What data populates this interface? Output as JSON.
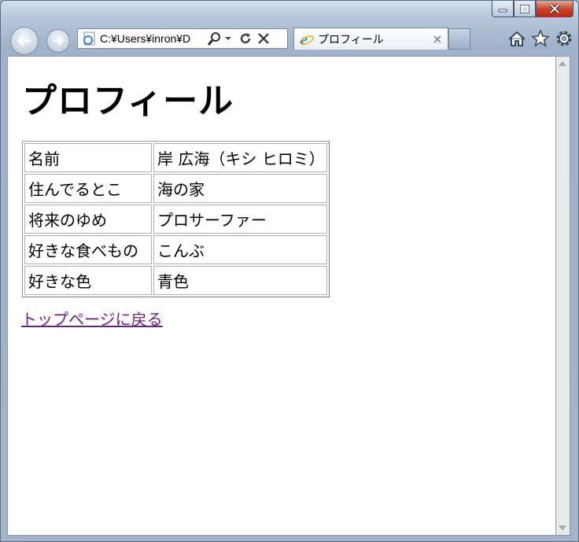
{
  "browser": {
    "address_text": "C:¥Users¥inron¥D",
    "tab_title": "プロフィール",
    "accent": "#c7432b"
  },
  "page": {
    "heading": "プロフィール",
    "rows": [
      {
        "label": "名前",
        "value": "岸 広海（キシ ヒロミ）"
      },
      {
        "label": "住んでるとこ",
        "value": "海の家"
      },
      {
        "label": "将来のゆめ",
        "value": "プロサーファー"
      },
      {
        "label": "好きな食べもの",
        "value": "こんぶ"
      },
      {
        "label": "好きな色",
        "value": "青色"
      }
    ],
    "back_link": "トップページに戻る",
    "link_color": "#6e1f8a"
  }
}
